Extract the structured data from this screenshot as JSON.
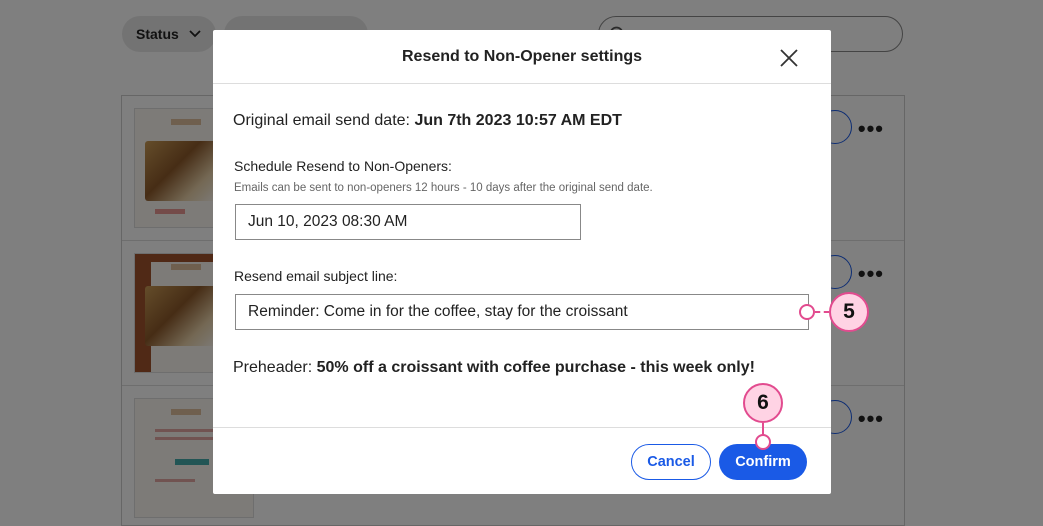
{
  "background": {
    "status_filter_label": "Status",
    "second_filter_label": "",
    "search_placeholder": ""
  },
  "modal": {
    "title": "Resend to Non-Opener settings",
    "original_send_date_label": "Original email send date:",
    "original_send_date_value": "Jun 7th 2023 10:57 AM EDT",
    "schedule_label": "Schedule Resend to Non-Openers:",
    "schedule_help": "Emails can be sent to non-openers 12 hours - 10 days after the original send date.",
    "schedule_value": "Jun 10, 2023 08:30 AM",
    "subject_label": "Resend email subject line:",
    "subject_value": "Reminder: Come in for the coffee, stay for the croissant",
    "preheader_label": "Preheader:",
    "preheader_value": "50% off a croissant with coffee purchase - this week only!",
    "cancel_label": "Cancel",
    "confirm_label": "Confirm"
  },
  "callouts": {
    "step_subject": "5",
    "step_confirm": "6"
  },
  "colors": {
    "accent": "#1a5ae6",
    "callout_border": "#e24b8f",
    "callout_fill": "#ffd3e4"
  }
}
